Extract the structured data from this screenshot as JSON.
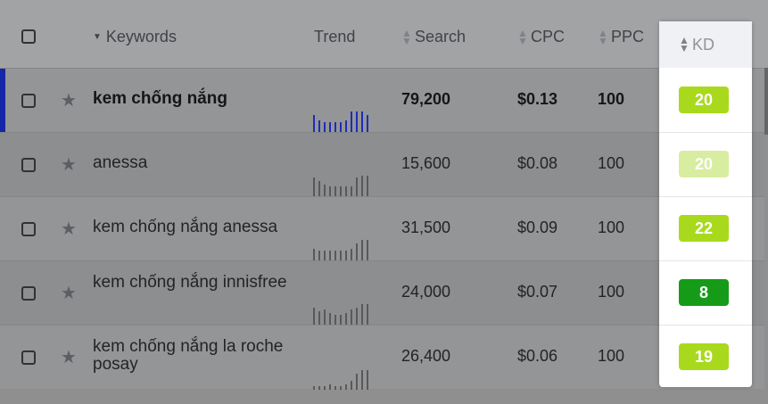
{
  "header": {
    "keywords": "Keywords",
    "trend": "Trend",
    "search": "Search",
    "cpc": "CPC",
    "ppc": "PPC",
    "kd": "KD"
  },
  "rows": [
    {
      "keyword": "kem chống nắng",
      "search": "79,200",
      "cpc": "$0.13",
      "ppc": "100",
      "kd": "20",
      "kd_color": "#a9d91d",
      "bold": true,
      "trend": [
        20,
        14,
        12,
        12,
        12,
        12,
        14,
        24,
        24,
        24,
        20
      ],
      "trend_color": "#1f2cb6"
    },
    {
      "keyword": "anessa",
      "search": "15,600",
      "cpc": "$0.08",
      "ppc": "100",
      "kd": "20",
      "kd_color": "#d8ed9f",
      "bold": false,
      "trend": [
        22,
        18,
        14,
        12,
        12,
        12,
        12,
        12,
        22,
        24,
        24
      ],
      "trend_color": "#58595b"
    },
    {
      "keyword": "kem chống nắng anessa",
      "search": "31,500",
      "cpc": "$0.09",
      "ppc": "100",
      "kd": "22",
      "kd_color": "#a9d91d",
      "bold": false,
      "trend": [
        14,
        12,
        12,
        12,
        12,
        12,
        12,
        14,
        20,
        24,
        24
      ],
      "trend_color": "#58595b"
    },
    {
      "keyword": "kem chống nắng innisfree",
      "search": "24,000",
      "cpc": "$0.07",
      "ppc": "100",
      "kd": "8",
      "kd_color": "#169b18",
      "bold": false,
      "trend": [
        20,
        16,
        18,
        14,
        12,
        12,
        14,
        18,
        20,
        24,
        24
      ],
      "trend_color": "#58595b"
    },
    {
      "keyword": "kem chống nắng la roche posay",
      "search": "26,400",
      "cpc": "$0.06",
      "ppc": "100",
      "kd": "19",
      "kd_color": "#a9d91d",
      "bold": false,
      "trend": [
        4,
        4,
        4,
        6,
        4,
        4,
        6,
        10,
        18,
        22,
        22
      ],
      "trend_color": "#58595b"
    }
  ]
}
